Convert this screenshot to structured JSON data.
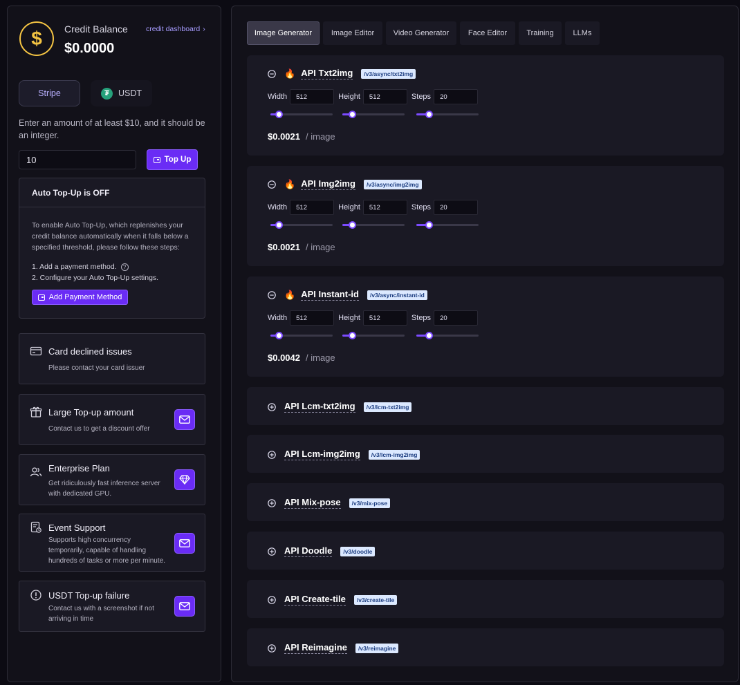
{
  "credit": {
    "label": "Credit Balance",
    "value": "$0.0000",
    "dashboard_link": "credit dashboard",
    "coin_glyph": "$"
  },
  "payment_tabs": [
    {
      "label": "Stripe",
      "active": true
    },
    {
      "label": "USDT",
      "active": false,
      "icon_glyph": "₮"
    }
  ],
  "amount": {
    "hint": "Enter an amount of at least $10, and it should be an integer.",
    "value": "10",
    "topup_label": "Top Up"
  },
  "auto_topup": {
    "title": "Auto Top-Up is OFF",
    "description": "To enable Auto Top-Up, which replenishes your credit balance automatically when it falls below a specified threshold, please follow these steps:",
    "steps": [
      "1. Add a payment method.",
      "2. Configure your Auto Top-Up settings."
    ],
    "help_glyph": "?",
    "add_payment_label": "Add Payment Method"
  },
  "info_cards": [
    {
      "title": "Card declined issues",
      "desc": "Please contact your card issuer",
      "icon": "credit-card-icon",
      "action": null
    },
    {
      "title": "Large Top-up amount",
      "desc": "Contact us to get a discount offer",
      "icon": "gift-icon",
      "action": "mail-icon"
    },
    {
      "title": "Enterprise Plan",
      "desc": "Get ridiculously fast inference server with dedicated GPU.",
      "icon": "users-icon",
      "action": "diamond-icon"
    },
    {
      "title": "Event Support",
      "desc": "Supports high concurrency temporarily, capable of handling hundreds of tasks or more per minute.",
      "icon": "calendar-icon",
      "action": "mail-icon"
    },
    {
      "title": "USDT Top-up failure",
      "desc": "Contact us with a screenshot if not arriving in time",
      "icon": "alert-circle-icon",
      "action": "mail-icon"
    }
  ],
  "tabs": [
    {
      "label": "Image Generator",
      "active": true
    },
    {
      "label": "Image Editor",
      "active": false
    },
    {
      "label": "Video Generator",
      "active": false
    },
    {
      "label": "Face Editor",
      "active": false
    },
    {
      "label": "Training",
      "active": false
    },
    {
      "label": "LLMs",
      "active": false
    }
  ],
  "param_labels": {
    "width": "Width",
    "height": "Height",
    "steps": "Steps"
  },
  "price_unit": "/ image",
  "apis": [
    {
      "name": "API Txt2img",
      "route": "/v3/async/txt2img",
      "expanded": true,
      "hot": true,
      "width": "512",
      "height": "512",
      "steps": "20",
      "price": "$0.0021",
      "slider_fraction": [
        0.13,
        0.15,
        0.2
      ]
    },
    {
      "name": "API Img2img",
      "route": "/v3/async/img2img",
      "expanded": true,
      "hot": true,
      "width": "512",
      "height": "512",
      "steps": "20",
      "price": "$0.0021",
      "slider_fraction": [
        0.13,
        0.15,
        0.2
      ]
    },
    {
      "name": "API Instant-id",
      "route": "/v3/async/instant-id",
      "expanded": true,
      "hot": true,
      "width": "512",
      "height": "512",
      "steps": "20",
      "price": "$0.0042",
      "slider_fraction": [
        0.13,
        0.15,
        0.2
      ]
    },
    {
      "name": "API Lcm-txt2img",
      "route": "/v3/lcm-txt2img",
      "expanded": false
    },
    {
      "name": "API Lcm-img2img",
      "route": "/v3/lcm-img2img",
      "expanded": false
    },
    {
      "name": "API Mix-pose",
      "route": "/v3/mix-pose",
      "expanded": false
    },
    {
      "name": "API Doodle",
      "route": "/v3/doodle",
      "expanded": false
    },
    {
      "name": "API Create-tile",
      "route": "/v3/create-tile",
      "expanded": false
    },
    {
      "name": "API Reimagine",
      "route": "/v3/reimagine",
      "expanded": false
    }
  ],
  "colors": {
    "accent": "#6a2cf5",
    "coin": "#f4c443",
    "tether": "#26a17b",
    "badge_bg": "#dce9ff"
  }
}
